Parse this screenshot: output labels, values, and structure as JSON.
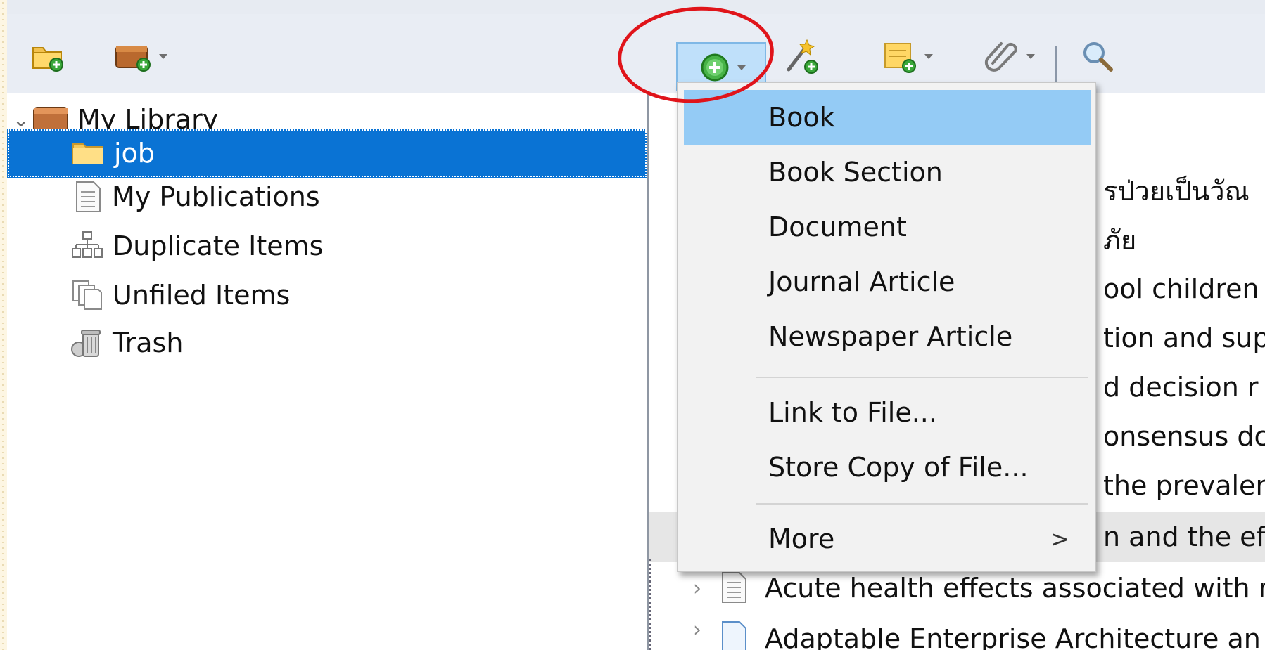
{
  "topstrip": {
    "caption": ""
  },
  "toolbar": {
    "new_collection": "new-collection-icon",
    "new_library": "new-library-icon",
    "new_item": "new-item-icon",
    "add_by_identifier": "magic-wand-icon",
    "new_note": "new-note-icon",
    "add_attachment": "paperclip-icon",
    "search": "search-icon"
  },
  "sidebar": {
    "items": [
      {
        "label": "My Library"
      },
      {
        "label": "job"
      },
      {
        "label": "My Publications"
      },
      {
        "label": "Duplicate Items"
      },
      {
        "label": "Unfiled Items"
      },
      {
        "label": "Trash"
      }
    ]
  },
  "items_list": {
    "rows": [
      {
        "text": "รป่วยเป็นวัณ"
      },
      {
        "text": "ภัย"
      },
      {
        "text": "ool children"
      },
      {
        "text": "tion and sup"
      },
      {
        "text": "d decision r"
      },
      {
        "text": "onsensus dc"
      },
      {
        "text": "the prevalen"
      },
      {
        "text": "n and the ef"
      },
      {
        "text": "Acute health effects associated with r"
      },
      {
        "text": "Adaptable Enterprise Architecture an"
      }
    ]
  },
  "new_item_menu": {
    "items": [
      {
        "label": "Book"
      },
      {
        "label": "Book Section"
      },
      {
        "label": "Document"
      },
      {
        "label": "Journal Article"
      },
      {
        "label": "Newspaper Article"
      },
      {
        "label": "Link to File..."
      },
      {
        "label": "Store Copy of File..."
      },
      {
        "label": "More"
      }
    ],
    "submenu_arrow": ">"
  },
  "colors": {
    "selection": "#0a73d4",
    "menu_hover": "#94cbf5",
    "annotation": "#e0141a"
  }
}
